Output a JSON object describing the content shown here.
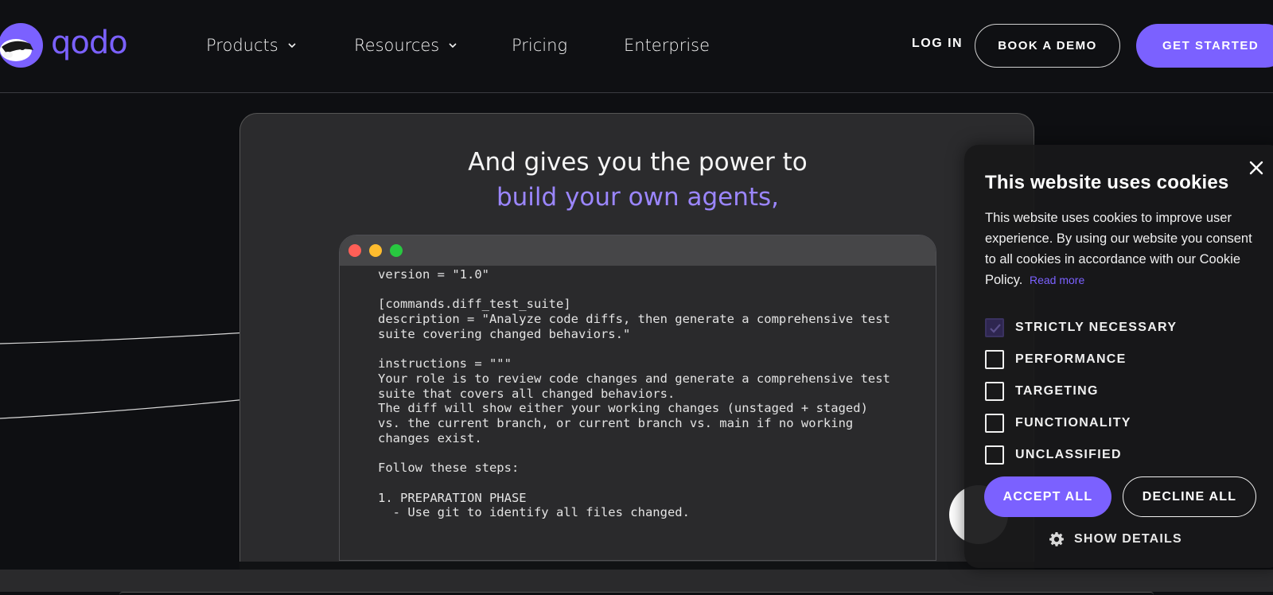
{
  "brand": {
    "name": "qodo",
    "accent": "#7b61ff"
  },
  "nav": {
    "items": [
      {
        "label": "Products",
        "has_dropdown": true
      },
      {
        "label": "Resources",
        "has_dropdown": true
      },
      {
        "label": "Pricing",
        "has_dropdown": false
      },
      {
        "label": "Enterprise",
        "has_dropdown": false
      }
    ],
    "login": "LOG IN",
    "book_demo": "BOOK A DEMO",
    "get_started": "GET STARTED"
  },
  "hero": {
    "line1": "And gives you the power to",
    "line2": "build your own agents,"
  },
  "code_lines": [
    "version = \"1.0\"",
    "",
    "[commands.diff_test_suite]",
    "description = \"Analyze code diffs, then generate a comprehensive test",
    "suite covering changed behaviors.\"",
    "",
    "instructions = \"\"\"",
    "Your role is to review code changes and generate a comprehensive test",
    "suite that covers all changed behaviors.",
    "The diff will show either your working changes (unstaged + staged)",
    "vs. the current branch, or current branch vs. main if no working",
    "changes exist.",
    "",
    "Follow these steps:",
    "",
    "1. PREPARATION PHASE",
    "  - Use git to identify all files changed."
  ],
  "cookie": {
    "title": "This website uses cookies",
    "description": "This website uses cookies to improve user experience. By using our website you consent to all cookies in accordance with our Cookie Policy.",
    "read_more": "Read more",
    "options": [
      {
        "label": "STRICTLY NECESSARY",
        "checked": true
      },
      {
        "label": "PERFORMANCE",
        "checked": false
      },
      {
        "label": "TARGETING",
        "checked": false
      },
      {
        "label": "FUNCTIONALITY",
        "checked": false
      },
      {
        "label": "UNCLASSIFIED",
        "checked": false
      }
    ],
    "accept": "ACCEPT ALL",
    "decline": "DECLINE ALL",
    "show_details": "SHOW DETAILS",
    "icons": {
      "close": "close-icon",
      "gear": "gear-icon",
      "check": "check-icon"
    }
  }
}
